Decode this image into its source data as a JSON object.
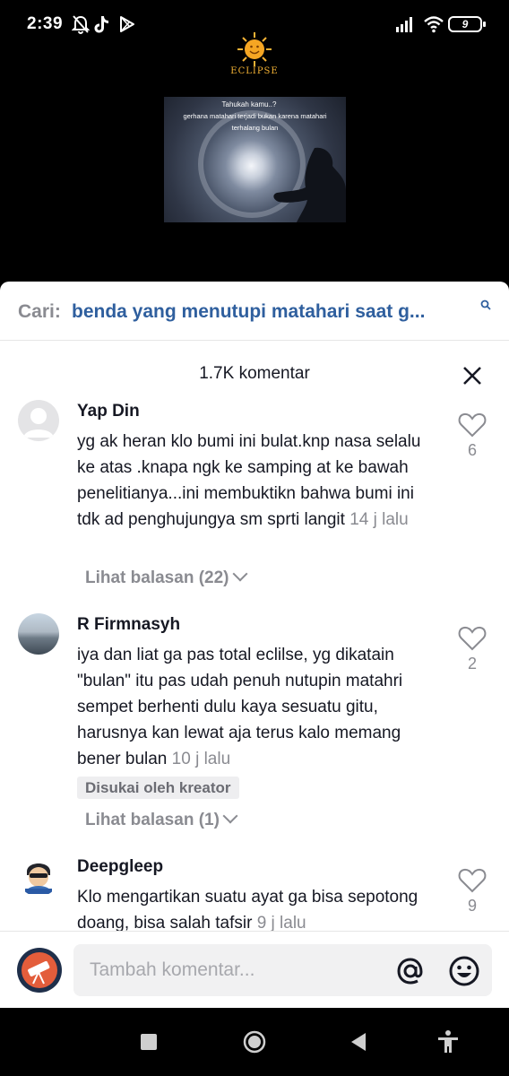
{
  "status_bar": {
    "time": "2:39",
    "battery": "9",
    "icons": [
      "notifications-off-icon",
      "tiktok-icon",
      "play-store-icon",
      "signal-icon",
      "wifi-icon",
      "battery-icon"
    ]
  },
  "video": {
    "logo_text": "ECLIPSE",
    "card_title": "Tahukah kamu..?",
    "card_line1": "gerhana matahari terjadi bukan karena matahari",
    "card_line2": "terhalang bulan"
  },
  "search": {
    "prefix": "Cari:",
    "query": "benda yang menutupi matahari saat g..."
  },
  "comments_header": {
    "count_label": "1.7K komentar"
  },
  "comments": [
    {
      "user": "Yap Din",
      "text": "yg ak heran klo bumi ini bulat.knp nasa selalu ke atas .knapa ngk ke samping at ke bawah penelitianya...ini membuktikn bahwa bumi ini tdk ad penghujungya sm sprti langit",
      "time": "14 j lalu",
      "likes": "6",
      "replies": "Lihat balasan (22)"
    },
    {
      "user": "R Firmnasyh",
      "text": "iya dan liat ga pas total eclilse, yg dikatain \"bulan\" itu pas udah penuh nutupin matahri sempet berhenti dulu kaya sesuatu gitu, harusnya kan lewat aja terus kalo memang bener bulan",
      "time": "10 j lalu",
      "likes": "2",
      "badge": "Disukai oleh kreator",
      "replies": "Lihat balasan (1)"
    },
    {
      "user": "Deepgleep",
      "text": "Klo mengartikan suatu ayat ga bisa sepotong doang, bisa salah tafsir",
      "time": "9 j lalu",
      "likes": "9"
    }
  ],
  "input": {
    "placeholder": "Tambah komentar..."
  },
  "colors": {
    "search_query": "#2f5f9e",
    "muted": "#8a8b91",
    "text": "#161823"
  }
}
